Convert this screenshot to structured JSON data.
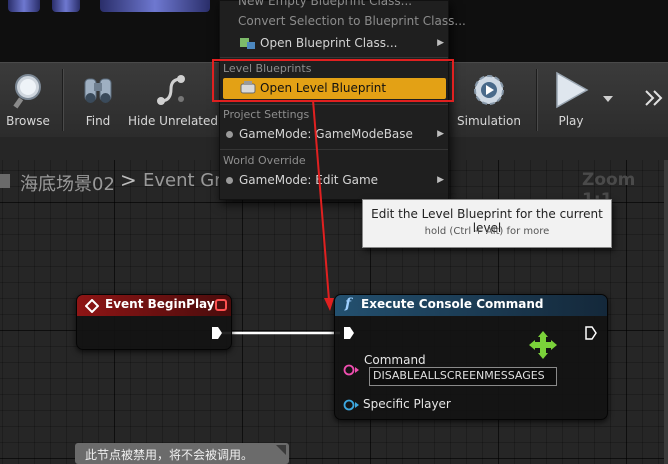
{
  "toolbar": {
    "buttons": [
      {
        "label": "Browse",
        "icon": "magnifier-icon"
      },
      {
        "label": "Find",
        "icon": "binoculars-icon"
      },
      {
        "label": "Hide Unrelated",
        "icon": "hide-unrelated-icon"
      },
      {
        "label": "Simulation",
        "icon": "simulation-gear-icon"
      },
      {
        "label": "Play",
        "icon": "play-icon"
      }
    ],
    "more_icon": "double-chevron-right-icon"
  },
  "menu": {
    "top_cut_item": "New Empty Blueprint Class...",
    "convert_item": "Convert Selection to Blueprint Class...",
    "open_class_item": "Open Blueprint Class...",
    "section_level": "Level Blueprints",
    "open_level_item": "Open Level Blueprint",
    "section_project": "Project Settings",
    "gamemode_base_item": "GameMode: GameModeBase",
    "section_world": "World Override",
    "gamemode_edit_item": "GameMode: Edit Game",
    "highlight_color": "#e3a115"
  },
  "tooltip": {
    "main": "Edit the Level Blueprint for the current level",
    "sub": "hold (Ctrl + Alt) for more"
  },
  "breadcrumb": {
    "level": "海底场景02",
    "separator": ">",
    "graph": "Event Gra"
  },
  "zoom": "Zoom 1:1",
  "nodes": {
    "begin_play": {
      "title": "Event BeginPlay",
      "header_color": "#7a1212"
    },
    "console": {
      "title": "Execute Console Command",
      "func_glyph": "f",
      "header_color": "#1c3b55",
      "command_label": "Command",
      "command_value": "DISABLEALLSCREENMESSAGES",
      "player_label": "Specific Player"
    }
  },
  "disabled_note": "此节点被禁用，将不会被调用。",
  "annotation_color": "#e02020"
}
